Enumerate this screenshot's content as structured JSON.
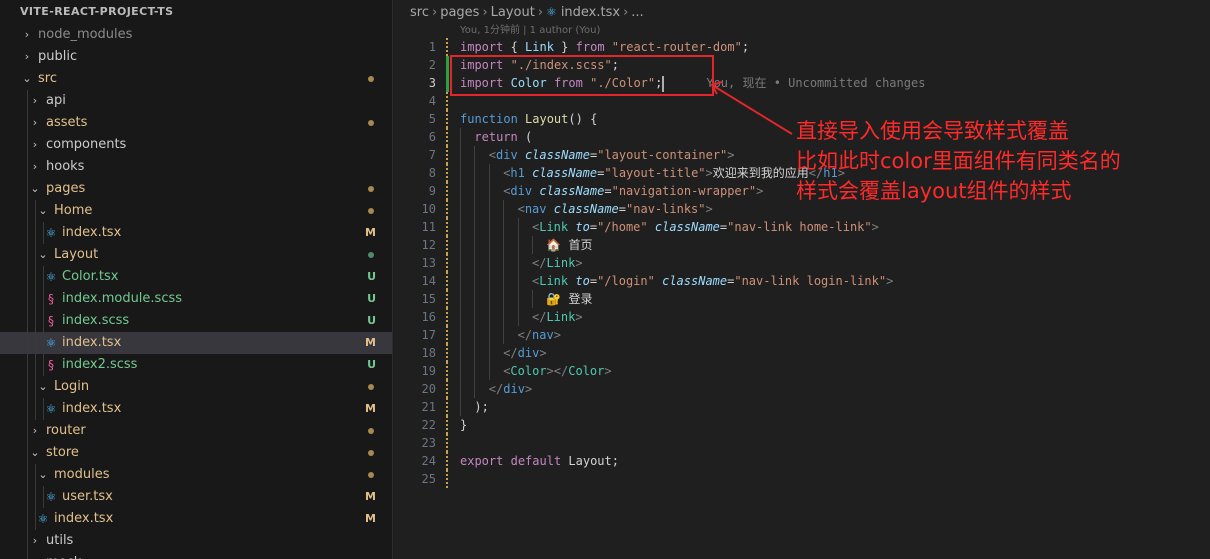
{
  "explorer": {
    "project_title": "VITE-REACT-PROJECT-TS",
    "items": [
      {
        "label": "node_modules",
        "kind": "folder",
        "expanded": false,
        "depth": 0,
        "status": "",
        "color": "#8b8b8b"
      },
      {
        "label": "public",
        "kind": "folder",
        "expanded": false,
        "depth": 0,
        "status": "",
        "color": "#cccccc"
      },
      {
        "label": "src",
        "kind": "folder",
        "expanded": true,
        "depth": 0,
        "status": "dot",
        "color": "#e2c08d"
      },
      {
        "label": "api",
        "kind": "folder",
        "expanded": false,
        "depth": 1,
        "status": "",
        "color": "#cccccc"
      },
      {
        "label": "assets",
        "kind": "folder",
        "expanded": false,
        "depth": 1,
        "status": "dot",
        "color": "#e2c08d"
      },
      {
        "label": "components",
        "kind": "folder",
        "expanded": false,
        "depth": 1,
        "status": "",
        "color": "#cccccc"
      },
      {
        "label": "hooks",
        "kind": "folder",
        "expanded": false,
        "depth": 1,
        "status": "",
        "color": "#cccccc"
      },
      {
        "label": "pages",
        "kind": "folder",
        "expanded": true,
        "depth": 1,
        "status": "dot",
        "color": "#e2c08d"
      },
      {
        "label": "Home",
        "kind": "folder",
        "expanded": true,
        "depth": 2,
        "status": "dot",
        "color": "#e2c08d"
      },
      {
        "label": "index.tsx",
        "kind": "tsx",
        "depth": 3,
        "status": "M",
        "color": "#e2c08d"
      },
      {
        "label": "Layout",
        "kind": "folder",
        "expanded": true,
        "depth": 2,
        "status": "dot-green",
        "color": "#e2c08d"
      },
      {
        "label": "Color.tsx",
        "kind": "tsx",
        "depth": 3,
        "status": "U",
        "color": "#73c991"
      },
      {
        "label": "index.module.scss",
        "kind": "scss",
        "depth": 3,
        "status": "U",
        "color": "#73c991"
      },
      {
        "label": "index.scss",
        "kind": "scss",
        "depth": 3,
        "status": "U",
        "color": "#73c991"
      },
      {
        "label": "index.tsx",
        "kind": "tsx",
        "depth": 3,
        "status": "M",
        "color": "#e2c08d",
        "selected": true
      },
      {
        "label": "index2.scss",
        "kind": "scss",
        "depth": 3,
        "status": "U",
        "color": "#73c991"
      },
      {
        "label": "Login",
        "kind": "folder",
        "expanded": true,
        "depth": 2,
        "status": "dot",
        "color": "#e2c08d"
      },
      {
        "label": "index.tsx",
        "kind": "tsx",
        "depth": 3,
        "status": "M",
        "color": "#e2c08d"
      },
      {
        "label": "router",
        "kind": "folder",
        "expanded": false,
        "depth": 1,
        "status": "dot",
        "color": "#e2c08d"
      },
      {
        "label": "store",
        "kind": "folder",
        "expanded": true,
        "depth": 1,
        "status": "dot",
        "color": "#e2c08d"
      },
      {
        "label": "modules",
        "kind": "folder",
        "expanded": true,
        "depth": 2,
        "status": "dot",
        "color": "#e2c08d"
      },
      {
        "label": "user.tsx",
        "kind": "tsx",
        "depth": 3,
        "status": "M",
        "color": "#e2c08d"
      },
      {
        "label": "index.tsx",
        "kind": "tsx",
        "depth": 2,
        "status": "M",
        "color": "#e2c08d"
      },
      {
        "label": "utils",
        "kind": "folder",
        "expanded": false,
        "depth": 1,
        "status": "",
        "color": "#cccccc"
      },
      {
        "label": "mock",
        "kind": "folder",
        "expanded": false,
        "depth": 1,
        "status": "",
        "color": "#cccccc"
      }
    ]
  },
  "breadcrumb": {
    "parts": [
      "src",
      "pages",
      "Layout"
    ],
    "file": "index.tsx",
    "more": "..."
  },
  "blame_header": "You, 1分钟前 | 1 author (You)",
  "inline_blame": "You, 现在 • Uncommitted changes",
  "code": {
    "active_line": 3,
    "lines": [
      {
        "n": "1",
        "mark": "modified",
        "indent": 0,
        "tokens": [
          [
            "kw",
            "import"
          ],
          [
            "plain",
            " "
          ],
          [
            "plain",
            "{ "
          ],
          [
            "var",
            "Link"
          ],
          [
            "plain",
            " } "
          ],
          [
            "kw",
            "from"
          ],
          [
            "plain",
            " "
          ],
          [
            "str",
            "\"react-router-dom\""
          ],
          [
            "plain",
            ";"
          ]
        ]
      },
      {
        "n": "2",
        "mark": "added",
        "indent": 0,
        "tokens": [
          [
            "kw",
            "import"
          ],
          [
            "plain",
            " "
          ],
          [
            "str",
            "\"./index.scss\""
          ],
          [
            "plain",
            ";"
          ]
        ]
      },
      {
        "n": "3",
        "mark": "added",
        "indent": 0,
        "tokens": [
          [
            "kw",
            "import"
          ],
          [
            "plain",
            " "
          ],
          [
            "var",
            "Color"
          ],
          [
            "plain",
            " "
          ],
          [
            "kw",
            "from"
          ],
          [
            "plain",
            " "
          ],
          [
            "str",
            "\"./Color\""
          ],
          [
            "plain",
            ";"
          ]
        ],
        "cursor": true
      },
      {
        "n": "4",
        "mark": "modified",
        "indent": 0,
        "tokens": []
      },
      {
        "n": "5",
        "mark": "modified",
        "indent": 0,
        "tokens": [
          [
            "kw2",
            "function"
          ],
          [
            "plain",
            " "
          ],
          [
            "fn",
            "Layout"
          ],
          [
            "plain",
            "() {"
          ]
        ]
      },
      {
        "n": "6",
        "mark": "modified",
        "indent": 1,
        "tokens": [
          [
            "kw",
            "return"
          ],
          [
            "plain",
            " ("
          ]
        ]
      },
      {
        "n": "7",
        "mark": "modified",
        "indent": 2,
        "tokens": [
          [
            "punc",
            "<"
          ],
          [
            "tag",
            "div"
          ],
          [
            "plain",
            " "
          ],
          [
            "attr",
            "className"
          ],
          [
            "plain",
            "="
          ],
          [
            "str",
            "\"layout-container\""
          ],
          [
            "punc",
            ">"
          ]
        ]
      },
      {
        "n": "8",
        "mark": "modified",
        "indent": 3,
        "tokens": [
          [
            "punc",
            "<"
          ],
          [
            "tag",
            "h1"
          ],
          [
            "plain",
            " "
          ],
          [
            "attr",
            "className"
          ],
          [
            "plain",
            "="
          ],
          [
            "str",
            "\"layout-title\""
          ],
          [
            "punc",
            ">"
          ],
          [
            "txt",
            "欢迎来到我的应用"
          ],
          [
            "punc",
            "</"
          ],
          [
            "tag",
            "h1"
          ],
          [
            "punc",
            ">"
          ]
        ]
      },
      {
        "n": "9",
        "mark": "modified",
        "indent": 3,
        "tokens": [
          [
            "punc",
            "<"
          ],
          [
            "tag",
            "div"
          ],
          [
            "plain",
            " "
          ],
          [
            "attr",
            "className"
          ],
          [
            "plain",
            "="
          ],
          [
            "str",
            "\"navigation-wrapper\""
          ],
          [
            "punc",
            ">"
          ]
        ]
      },
      {
        "n": "10",
        "mark": "modified",
        "indent": 4,
        "tokens": [
          [
            "punc",
            "<"
          ],
          [
            "tag",
            "nav"
          ],
          [
            "plain",
            " "
          ],
          [
            "attr",
            "className"
          ],
          [
            "plain",
            "="
          ],
          [
            "str",
            "\"nav-links\""
          ],
          [
            "punc",
            ">"
          ]
        ]
      },
      {
        "n": "11",
        "mark": "modified",
        "indent": 5,
        "tokens": [
          [
            "punc",
            "<"
          ],
          [
            "cmp",
            "Link"
          ],
          [
            "plain",
            " "
          ],
          [
            "attr",
            "to"
          ],
          [
            "plain",
            "="
          ],
          [
            "str",
            "\"/home\""
          ],
          [
            "plain",
            " "
          ],
          [
            "attr",
            "className"
          ],
          [
            "plain",
            "="
          ],
          [
            "str",
            "\"nav-link home-link\""
          ],
          [
            "punc",
            ">"
          ]
        ]
      },
      {
        "n": "12",
        "mark": "modified",
        "indent": 6,
        "tokens": [
          [
            "txt",
            "🏠 首页"
          ]
        ]
      },
      {
        "n": "13",
        "mark": "modified",
        "indent": 5,
        "tokens": [
          [
            "punc",
            "</"
          ],
          [
            "cmp",
            "Link"
          ],
          [
            "punc",
            ">"
          ]
        ]
      },
      {
        "n": "14",
        "mark": "modified",
        "indent": 5,
        "tokens": [
          [
            "punc",
            "<"
          ],
          [
            "cmp",
            "Link"
          ],
          [
            "plain",
            " "
          ],
          [
            "attr",
            "to"
          ],
          [
            "plain",
            "="
          ],
          [
            "str",
            "\"/login\""
          ],
          [
            "plain",
            " "
          ],
          [
            "attr",
            "className"
          ],
          [
            "plain",
            "="
          ],
          [
            "str",
            "\"nav-link login-link\""
          ],
          [
            "punc",
            ">"
          ]
        ]
      },
      {
        "n": "15",
        "mark": "modified",
        "indent": 6,
        "tokens": [
          [
            "txt",
            "🔐 登录"
          ]
        ]
      },
      {
        "n": "16",
        "mark": "modified",
        "indent": 5,
        "tokens": [
          [
            "punc",
            "</"
          ],
          [
            "cmp",
            "Link"
          ],
          [
            "punc",
            ">"
          ]
        ]
      },
      {
        "n": "17",
        "mark": "modified",
        "indent": 4,
        "tokens": [
          [
            "punc",
            "</"
          ],
          [
            "tag",
            "nav"
          ],
          [
            "punc",
            ">"
          ]
        ]
      },
      {
        "n": "18",
        "mark": "modified",
        "indent": 3,
        "tokens": [
          [
            "punc",
            "</"
          ],
          [
            "tag",
            "div"
          ],
          [
            "punc",
            ">"
          ]
        ]
      },
      {
        "n": "19",
        "mark": "modified",
        "indent": 3,
        "tokens": [
          [
            "punc",
            "<"
          ],
          [
            "cmp",
            "Color"
          ],
          [
            "punc",
            "></"
          ],
          [
            "cmp",
            "Color"
          ],
          [
            "punc",
            ">"
          ]
        ]
      },
      {
        "n": "20",
        "mark": "modified",
        "indent": 2,
        "tokens": [
          [
            "punc",
            "</"
          ],
          [
            "tag",
            "div"
          ],
          [
            "punc",
            ">"
          ]
        ]
      },
      {
        "n": "21",
        "mark": "modified",
        "indent": 1,
        "tokens": [
          [
            "plain",
            ");"
          ]
        ]
      },
      {
        "n": "22",
        "mark": "modified",
        "indent": 0,
        "tokens": [
          [
            "plain",
            "}"
          ]
        ]
      },
      {
        "n": "23",
        "mark": "modified",
        "indent": 0,
        "tokens": []
      },
      {
        "n": "24",
        "mark": "modified",
        "indent": 0,
        "tokens": [
          [
            "kw",
            "export"
          ],
          [
            "plain",
            " "
          ],
          [
            "kw",
            "default"
          ],
          [
            "plain",
            " "
          ],
          [
            "plain",
            "Layout;"
          ]
        ]
      },
      {
        "n": "25",
        "mark": "modified",
        "indent": 0,
        "tokens": []
      }
    ]
  },
  "annotation": {
    "lines": [
      "直接导入使用会导致样式覆盖",
      "比如此时color里面组件有同类名的",
      "样式会覆盖layout组件的样式"
    ],
    "color": "#ff2a2a"
  },
  "colors": {
    "modified_gutter": "#c9a24a",
    "added_gutter": "#2ea043",
    "tsx_icon": "#4fc1ff",
    "scss_icon": "#f05ea0"
  }
}
